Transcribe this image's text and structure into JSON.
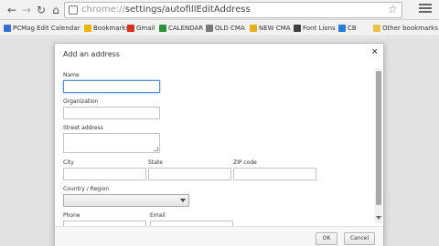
{
  "browser": {
    "url_scheme": "chrome://",
    "url_path": "settings/autofillEditAddress"
  },
  "bookmarks": [
    {
      "label": "PCMag Edit Calendar",
      "color": "#3b6fd6"
    },
    {
      "label": "Bookmarks",
      "color": "#f2b400"
    },
    {
      "label": "Gmail",
      "color": "#d93025"
    },
    {
      "label": "CALENDAR",
      "color": "#2f8f3a"
    },
    {
      "label": "OLD CMA",
      "color": "#7a7a7a"
    },
    {
      "label": "NEW CMA",
      "color": "#e0b020"
    },
    {
      "label": "Font Lions",
      "color": "#404040"
    },
    {
      "label": "CB",
      "color": "#2a7ad8"
    },
    {
      "label": "Other bookmarks",
      "color": "#e8c24a"
    }
  ],
  "dialog": {
    "title": "Add an address",
    "close_glyph": "×",
    "labels": {
      "name": "Name",
      "organization": "Organization",
      "street": "Street address",
      "city": "City",
      "state": "State",
      "zip": "ZIP code",
      "country": "Country / Region",
      "phone": "Phone",
      "email": "Email"
    },
    "buttons": {
      "ok": "OK",
      "cancel": "Cancel"
    }
  },
  "icons": {
    "back": "back-arrow-icon",
    "forward": "forward-arrow-icon",
    "reload": "reload-icon",
    "home": "home-icon",
    "star": "bookmark-star-icon",
    "menu": "menu-icon"
  }
}
